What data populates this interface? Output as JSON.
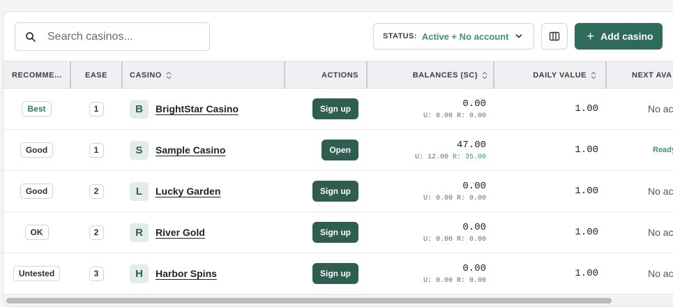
{
  "toolbar": {
    "search_placeholder": "Search casinos...",
    "status_label": "STATUS:",
    "status_value": "Active + No account",
    "add_label": "Add casino"
  },
  "columns": {
    "recommended": "RECOMME...",
    "ease": "EASE",
    "casino": "CASINO",
    "actions": "ACTIONS",
    "balances": "BALANCES (SC)",
    "daily_value": "DAILY VALUE",
    "next": "NEXT AVA"
  },
  "colors": {
    "accent": "#2f5d50",
    "status_green": "#3f9668"
  },
  "rows": [
    {
      "rec": "Best",
      "ease": "1",
      "initial": "B",
      "name": "BrightStar Casino",
      "action": "Sign up",
      "total": "0.00",
      "u": "U: 0.00",
      "r": "R: 0.00",
      "daily": "1.00",
      "next": "No ac"
    },
    {
      "rec": "Good",
      "ease": "1",
      "initial": "S",
      "name": "Sample Casino",
      "action": "Open",
      "total": "47.00",
      "u": "U: 12.00",
      "r": "R: 35.00",
      "daily": "1.00",
      "next": "Ready"
    },
    {
      "rec": "Good",
      "ease": "2",
      "initial": "L",
      "name": "Lucky Garden",
      "action": "Sign up",
      "total": "0.00",
      "u": "U: 0.00",
      "r": "R: 0.00",
      "daily": "1.00",
      "next": "No ac"
    },
    {
      "rec": "OK",
      "ease": "2",
      "initial": "R",
      "name": "River Gold",
      "action": "Sign up",
      "total": "0.00",
      "u": "U: 0.00",
      "r": "R: 0.00",
      "daily": "1.00",
      "next": "No ac"
    },
    {
      "rec": "Untested",
      "ease": "3",
      "initial": "H",
      "name": "Harbor Spins",
      "action": "Sign up",
      "total": "0.00",
      "u": "U: 0.00",
      "r": "R: 0.00",
      "daily": "1.00",
      "next": "No ac"
    }
  ]
}
